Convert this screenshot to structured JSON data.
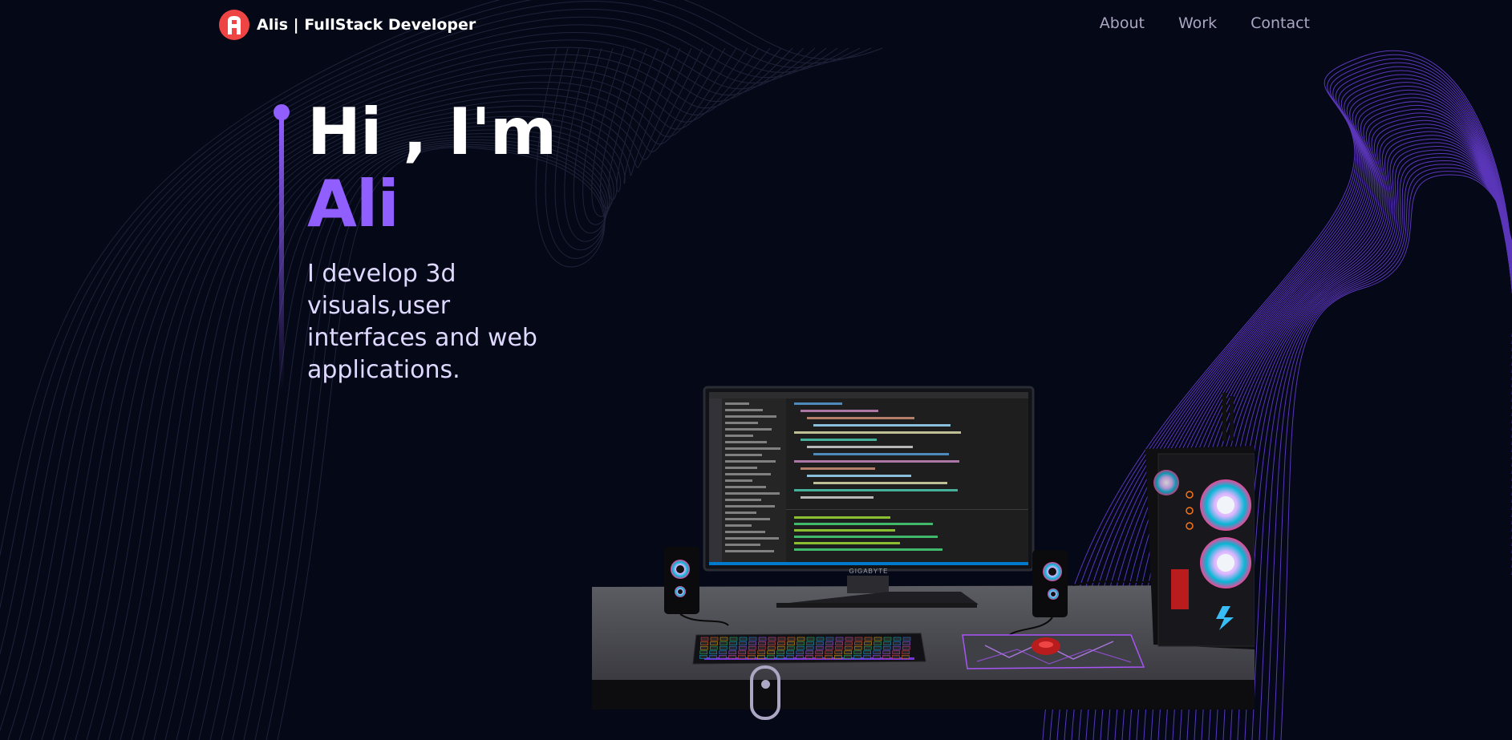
{
  "nav": {
    "brand_name": "Alis",
    "brand_subtitle": "| FullStack Developer",
    "links": [
      "About",
      "Work",
      "Contact"
    ]
  },
  "hero": {
    "greeting": "Hi , I'm",
    "name": "Ali",
    "subtitle": "I develop 3d visuals,user interfaces and web applications."
  },
  "scene": {
    "monitor_brand": "GIGABYTE"
  },
  "colors": {
    "background": "#050816",
    "accent": "#915eff",
    "logo": "#ef4444",
    "nav_text": "#aaa6c3",
    "subtitle_text": "#dfd9ff"
  },
  "icons": {
    "logo": "logo-icon",
    "scroll": "mouse-scroll-icon"
  }
}
